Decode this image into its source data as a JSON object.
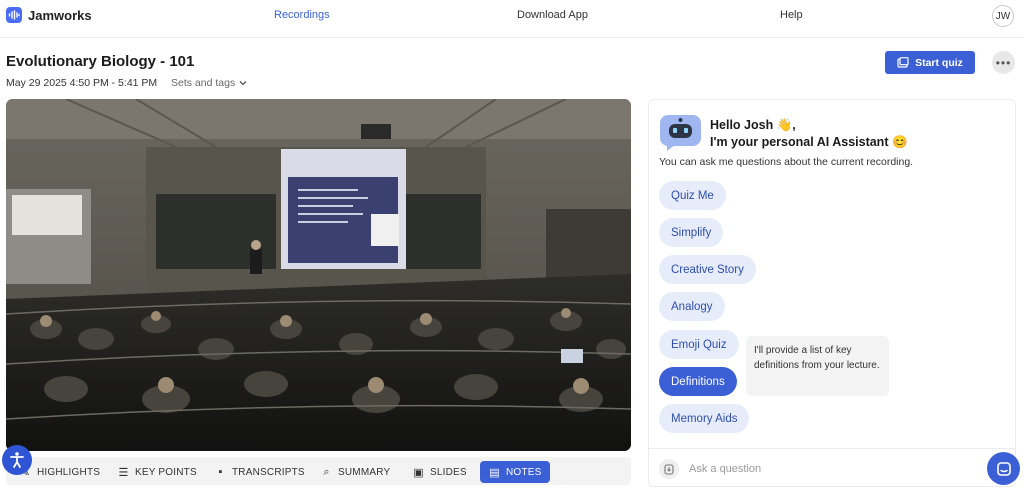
{
  "app": {
    "name": "Jamworks"
  },
  "nav": {
    "links": [
      {
        "label": "Recordings",
        "active": true
      },
      {
        "label": "Download App",
        "active": false
      },
      {
        "label": "Help",
        "active": false
      }
    ],
    "avatar_initials": "JW"
  },
  "recording": {
    "title": "Evolutionary Biology - 101",
    "datetime": "May 29 2025 4:50 PM - 5:41 PM",
    "tags_label": "Sets and tags",
    "start_quiz_label": "Start quiz"
  },
  "tabs": [
    {
      "label": "HIGHLIGHTS",
      "icon": "highlight-icon",
      "active": false
    },
    {
      "label": "KEY POINTS",
      "icon": "list-icon",
      "active": false
    },
    {
      "label": "TRANSCRIPTS",
      "icon": "speech-bubble-icon",
      "active": false
    },
    {
      "label": "SUMMARY",
      "icon": "search-icon",
      "active": false
    },
    {
      "label": "SLIDES",
      "icon": "image-icon",
      "active": false
    },
    {
      "label": "NOTES",
      "icon": "notes-icon",
      "active": true
    }
  ],
  "assistant": {
    "greeting_line1": "Hello Josh 👋,",
    "greeting_line2": "I'm your personal AI Assistant 😊",
    "intro": "You can ask me questions about the current recording.",
    "chips": [
      {
        "label": "Quiz Me",
        "active": false
      },
      {
        "label": "Simplify",
        "active": false
      },
      {
        "label": "Creative Story",
        "active": false
      },
      {
        "label": "Analogy",
        "active": false
      },
      {
        "label": "Emoji Quiz",
        "active": false
      },
      {
        "label": "Definitions",
        "active": true
      },
      {
        "label": "Memory Aids",
        "active": false
      }
    ],
    "tooltip": "I'll provide a list of key definitions from your lecture.",
    "ask_placeholder": "Ask a question"
  },
  "colors": {
    "accent": "#3b5fd4",
    "chip_bg": "#e6ecfa",
    "chip_text": "#2f4fae"
  }
}
